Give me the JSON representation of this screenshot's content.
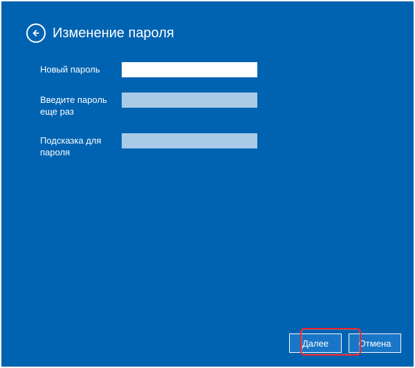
{
  "header": {
    "title": "Изменение пароля"
  },
  "form": {
    "new_password": {
      "label": "Новый пароль",
      "value": ""
    },
    "confirm_password": {
      "label": "Введите пароль еще раз",
      "value": ""
    },
    "hint": {
      "label": "Подсказка для пароля",
      "value": ""
    }
  },
  "footer": {
    "next_label": "Далее",
    "cancel_label": "Отмена"
  }
}
